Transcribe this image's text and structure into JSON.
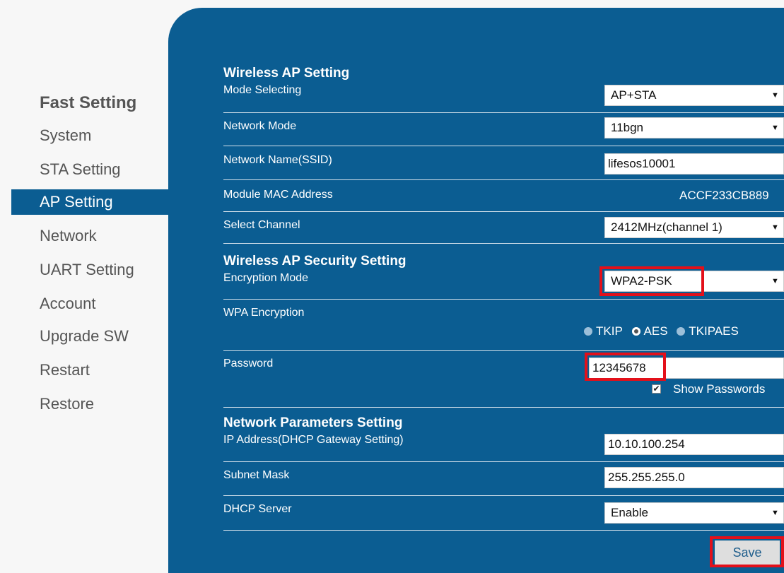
{
  "sidebar": {
    "heading": "Fast Setting",
    "items": [
      {
        "label": "System"
      },
      {
        "label": "STA Setting"
      },
      {
        "label": "AP Setting"
      },
      {
        "label": "Network"
      },
      {
        "label": "UART Setting"
      },
      {
        "label": "Account"
      },
      {
        "label": "Upgrade SW"
      },
      {
        "label": "Restart"
      },
      {
        "label": "Restore"
      }
    ],
    "active": "AP Setting"
  },
  "ap": {
    "title": "Wireless AP Setting",
    "mode_label": "Mode Selecting",
    "mode_value": "AP+STA",
    "netmode_label": "Network Mode",
    "netmode_value": "11bgn",
    "ssid_label": "Network Name(SSID)",
    "ssid_value": "lifesos10001",
    "mac_label": "Module MAC Address",
    "mac_value": "ACCF233CB889",
    "channel_label": "Select Channel",
    "channel_value": "2412MHz(channel 1)"
  },
  "security": {
    "title": "Wireless AP Security Setting",
    "enc_label": "Encryption Mode",
    "enc_value": "WPA2-PSK",
    "wpa_label": "WPA Encryption",
    "radios": [
      {
        "label": "TKIP",
        "checked": false
      },
      {
        "label": "AES",
        "checked": true
      },
      {
        "label": "TKIPAES",
        "checked": false
      }
    ],
    "password_label": "Password",
    "password_value": "12345678",
    "show_label": "Show Passwords",
    "show_checked": true
  },
  "netparams": {
    "title": "Network Parameters Setting",
    "ip_label": "IP Address(DHCP Gateway Setting)",
    "ip_value": "10.10.100.254",
    "mask_label": "Subnet Mask",
    "mask_value": "255.255.255.0",
    "dhcp_label": "DHCP Server",
    "dhcp_value": "Enable"
  },
  "save_label": "Save",
  "colors": {
    "panel": "#0b5d92",
    "highlight": "#e3101a",
    "background": "#f7f7f7"
  },
  "icons": {
    "dropdown": "down-triangle",
    "checkbox": "check-mark"
  }
}
